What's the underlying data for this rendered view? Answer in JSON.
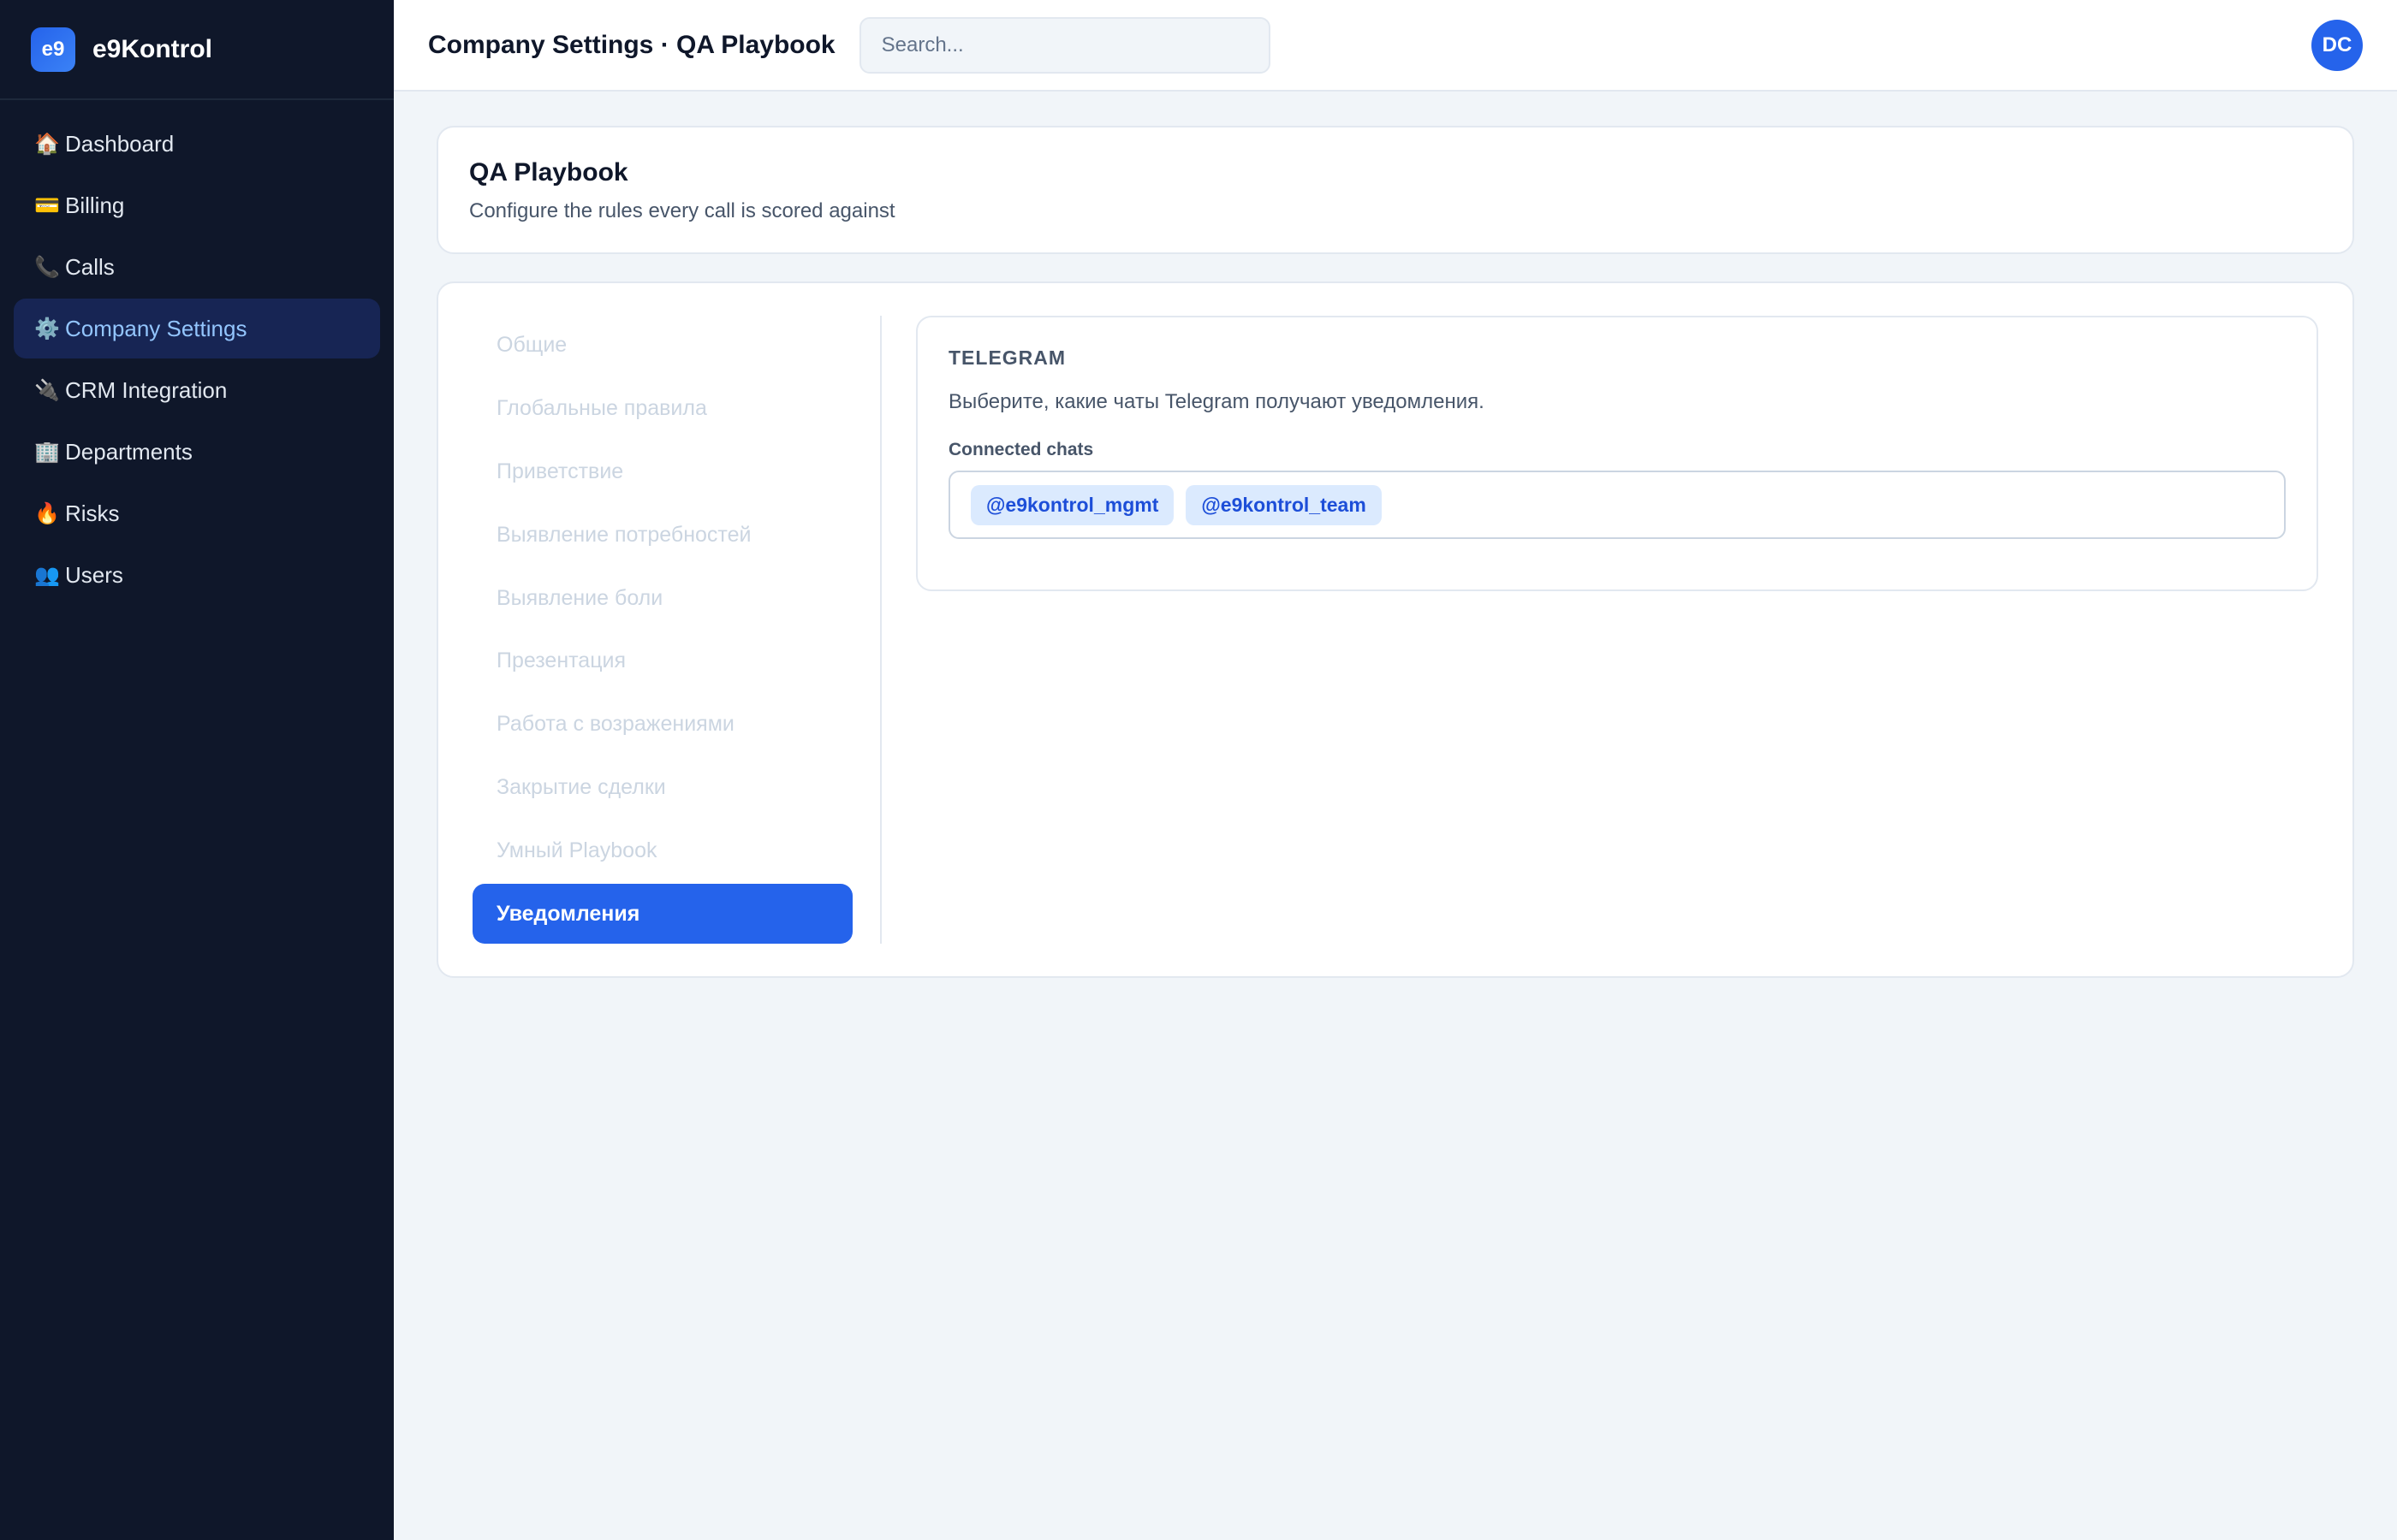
{
  "brand": {
    "logo_text": "e9",
    "name": "e9Kontrol"
  },
  "sidebar": {
    "items": [
      {
        "icon": "🏠",
        "label": "Dashboard"
      },
      {
        "icon": "💳",
        "label": "Billing"
      },
      {
        "icon": "📞",
        "label": "Calls"
      },
      {
        "icon": "⚙️",
        "label": "Company Settings",
        "active": true
      },
      {
        "icon": "🔌",
        "label": "CRM Integration"
      },
      {
        "icon": "🏢",
        "label": "Departments"
      },
      {
        "icon": "🔥",
        "label": "Risks"
      },
      {
        "icon": "👥",
        "label": "Users"
      }
    ]
  },
  "topbar": {
    "title": "Company Settings · QA Playbook",
    "search_placeholder": "Search...",
    "avatar_initials": "DC"
  },
  "header": {
    "title": "QA Playbook",
    "subtitle": "Configure the rules every call is scored against"
  },
  "subnav": {
    "items": [
      "Общие",
      "Глобальные правила",
      "Приветствие",
      "Выявление потребностей",
      "Выявление боли",
      "Презентация",
      "Работа с возражениями",
      "Закрытие сделки",
      "Умный Playbook",
      "Уведомления"
    ],
    "active_index": 9
  },
  "panel": {
    "title": "TELEGRAM",
    "description": "Выберите, какие чаты Telegram получают уведомления.",
    "field_label": "Connected chats",
    "chips": [
      "@e9kontrol_mgmt",
      "@e9kontrol_team"
    ]
  },
  "colors": {
    "sidebar_bg": "#0f172a",
    "accent": "#2563eb",
    "active_nav_bg": "#172554",
    "active_nav_text": "#93c5fd",
    "chip_bg": "#dbeafe",
    "chip_text": "#1d4ed8"
  }
}
